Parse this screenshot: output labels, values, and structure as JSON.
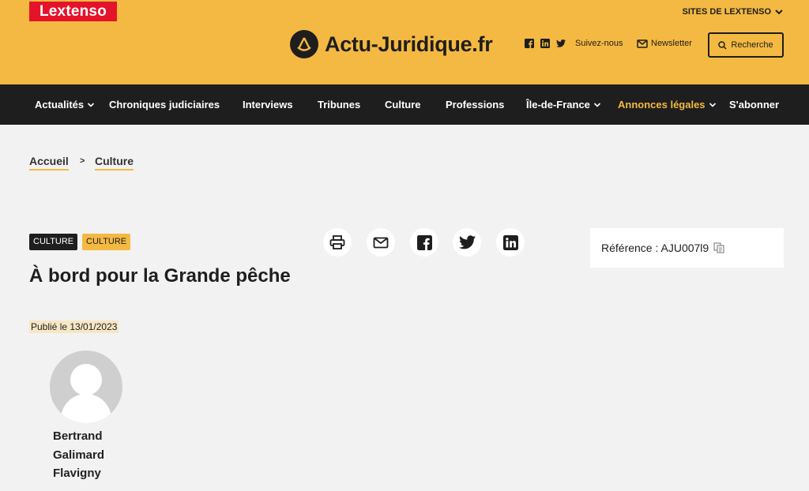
{
  "header": {
    "publisher": "Lextenso",
    "sites_menu": "SITES DE LEXTENSO",
    "brand": "Actu-Juridique.fr",
    "follow": "Suivez-nous",
    "newsletter": "Newsletter",
    "search": "Recherche",
    "icons": [
      "facebook-icon",
      "linkedin-icon",
      "twitter-icon",
      "mail-icon",
      "search-icon"
    ]
  },
  "nav": {
    "items": [
      {
        "label": "Actualités",
        "dropdown": true
      },
      {
        "label": "Chroniques judiciaires"
      },
      {
        "label": "Interviews"
      },
      {
        "label": "Tribunes"
      },
      {
        "label": "Culture"
      },
      {
        "label": "Professions"
      },
      {
        "label": "Île-de-France",
        "dropdown": true
      },
      {
        "label": "Annonces légales",
        "dropdown": true,
        "accent": true
      },
      {
        "label": "S'abonner"
      }
    ]
  },
  "breadcrumb": {
    "items": [
      "Accueil",
      "Culture"
    ],
    "separator": ">"
  },
  "article": {
    "tags": [
      "CULTURE",
      "CULTURE"
    ],
    "title": "À bord pour la Grande pêche",
    "published": "Publié le 13/01/2023",
    "author": {
      "lines": [
        "Bertrand",
        "Galimard",
        "Flavigny"
      ]
    },
    "reference": "Référence : AJU007l9",
    "share_icons": [
      "print-icon",
      "mail-icon",
      "facebook-icon",
      "twitter-icon",
      "linkedin-icon"
    ]
  },
  "colors": {
    "accent": "#f4b942",
    "nav_bg": "#1e1e1e",
    "brand_red": "#e4132a",
    "page_bg": "#f2f2f2"
  }
}
